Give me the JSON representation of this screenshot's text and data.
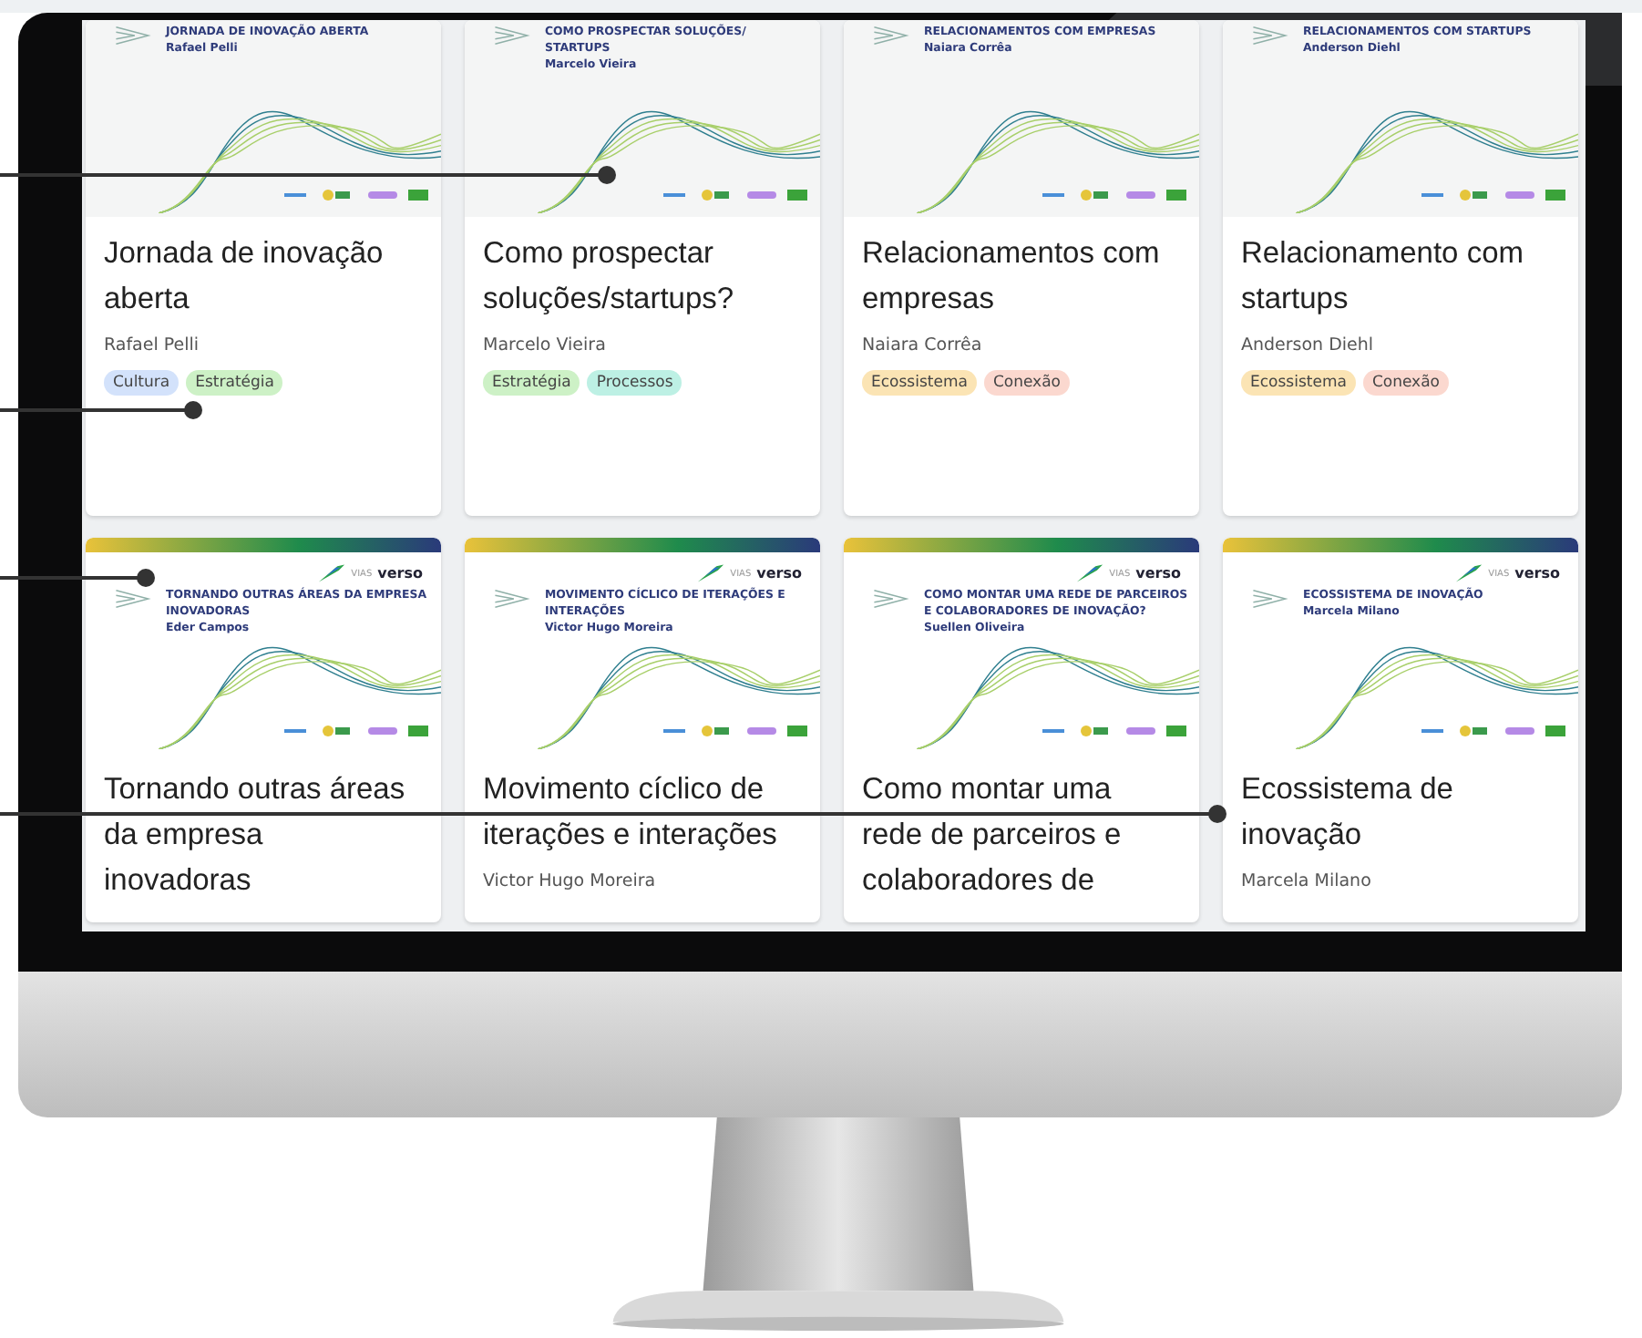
{
  "cards": [
    {
      "thumbnail": {
        "kind": "plain",
        "heading": "JORNADA DE INOVAÇÃO ABERTA",
        "speaker": "Rafael Pelli"
      },
      "title": "Jornada de inovação aberta",
      "author": "Rafael Pelli",
      "tags": [
        {
          "label": "Cultura",
          "color": "#d3e2fb"
        },
        {
          "label": "Estratégia",
          "color": "#cdf1c6"
        }
      ]
    },
    {
      "thumbnail": {
        "kind": "plain",
        "heading": "COMO PROSPECTAR SOLUÇÕES/ STARTUPS",
        "speaker": "Marcelo Vieira"
      },
      "title": "Como prospectar soluções/startups?",
      "author": "Marcelo Vieira",
      "tags": [
        {
          "label": "Estratégia",
          "color": "#cdf1c6"
        },
        {
          "label": "Processos",
          "color": "#bdf0e4"
        }
      ]
    },
    {
      "thumbnail": {
        "kind": "plain",
        "heading": "RELACIONAMENTOS COM EMPRESAS",
        "speaker": "Naiara Corrêa"
      },
      "title": "Relacionamentos com empresas",
      "author": "Naiara Corrêa",
      "tags": [
        {
          "label": "Ecossistema",
          "color": "#fbe4b4"
        },
        {
          "label": "Conexão",
          "color": "#fbd8cf"
        }
      ]
    },
    {
      "thumbnail": {
        "kind": "plain",
        "heading": "RELACIONAMENTOS COM STARTUPS",
        "speaker": "Anderson Diehl"
      },
      "title": "Relacionamento com startups",
      "author": "Anderson Diehl",
      "tags": [
        {
          "label": "Ecossistema",
          "color": "#fbe4b4"
        },
        {
          "label": "Conexão",
          "color": "#fbd8cf"
        }
      ]
    },
    {
      "thumbnail": {
        "kind": "branded",
        "brand_prefix": "VIAS",
        "brand": "verso",
        "heading": "TORNANDO OUTRAS ÁREAS DA EMPRESA INOVADORAS",
        "speaker": "Eder Campos"
      },
      "title": "Tornando outras áreas da empresa inovadoras"
    },
    {
      "thumbnail": {
        "kind": "branded",
        "brand_prefix": "VIAS",
        "brand": "verso",
        "heading": "MOVIMENTO CÍCLICO DE ITERAÇÕES E INTERAÇÕES",
        "speaker": "Victor Hugo Moreira"
      },
      "title": "Movimento cíclico de iterações e interações",
      "author": "Victor Hugo Moreira"
    },
    {
      "thumbnail": {
        "kind": "branded",
        "brand_prefix": "VIAS",
        "brand": "verso",
        "heading": "COMO MONTAR UMA REDE DE PARCEIROS E COLABORADORES DE INOVAÇÃO?",
        "speaker": "Suellen Oliveira"
      },
      "title": "Como montar uma rede de parceiros e colaboradores de"
    },
    {
      "thumbnail": {
        "kind": "branded",
        "brand_prefix": "VIAS",
        "brand": "verso",
        "heading": "ECOSSISTEMA DE INOVAÇÃO",
        "speaker": "Marcela Milano"
      },
      "title": "Ecossistema de inovação",
      "author": "Marcela Milano"
    }
  ]
}
